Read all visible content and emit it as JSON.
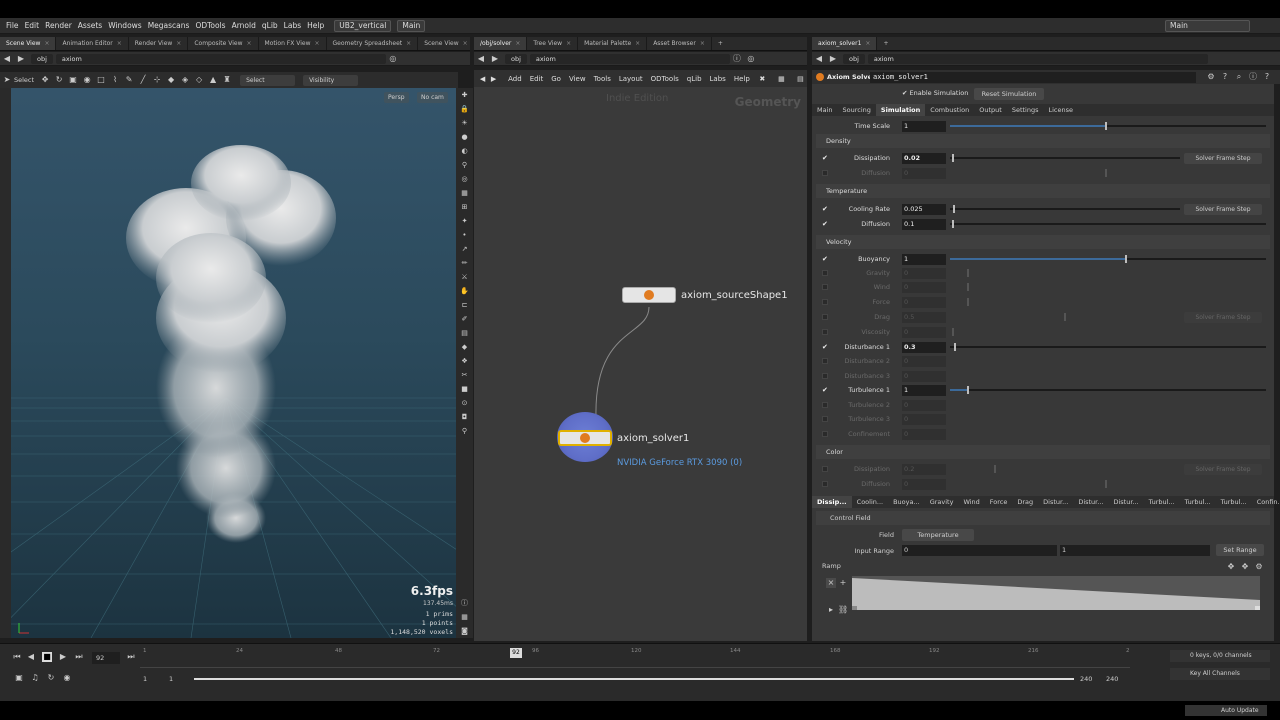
{
  "menu": [
    "File",
    "Edit",
    "Render",
    "Assets",
    "Windows",
    "Megascans",
    "ODTools",
    "Arnold",
    "qLib",
    "Labs",
    "Help"
  ],
  "desktop": "UB2_vertical",
  "desktop_main": "Main",
  "top_right_main": "Main",
  "left_tabs": [
    "Scene View",
    "Animation Editor",
    "Render View",
    "Composite View",
    "Motion FX View",
    "Geometry Spreadsheet",
    "Scene View"
  ],
  "mid_tabs": [
    "/obj/solver",
    "Tree View",
    "Material Palette",
    "Asset Browser"
  ],
  "right_tabs": [
    "axiom_solver1"
  ],
  "path_obj": "obj",
  "path_axiom": "axiom",
  "viewport": {
    "select": "Select",
    "select_mode": "Select",
    "visibility": "Visibility",
    "persp": "Persp",
    "cam": "No cam",
    "fps": "6.3fps",
    "ms": "137.45ms",
    "prims": "1  prims",
    "points": "1  points",
    "voxels": "1,148,520 voxels"
  },
  "network": {
    "menu": [
      "Add",
      "Edit",
      "Go",
      "View",
      "Tools",
      "Layout",
      "ODTools",
      "qLib",
      "Labs",
      "Help"
    ],
    "watermark1": "Indie Edition",
    "watermark2": "Geometry",
    "node1": "axiom_sourceShape1",
    "node2": "axiom_solver1",
    "gpu": "NVIDIA GeForce RTX 3090 (0)"
  },
  "params": {
    "type": "Axiom Solver",
    "name": "axiom_solver1",
    "enable_sim": "Enable Simulation",
    "reset_sim": "Reset Simulation",
    "tabs": [
      "Main",
      "Sourcing",
      "Simulation",
      "Combustion",
      "Output",
      "Settings",
      "License"
    ],
    "time_scale_label": "Time Scale",
    "time_scale": "1",
    "sec_density": "Density",
    "sec_temperature": "Temperature",
    "sec_velocity": "Velocity",
    "sec_color": "Color",
    "rows": {
      "dissipation": {
        "label": "Dissipation",
        "value": "0.02",
        "menu": "Solver Frame Step"
      },
      "diffusion": {
        "label": "Diffusion",
        "value": "0"
      },
      "cooling": {
        "label": "Cooling Rate",
        "value": "0.025",
        "menu": "Solver Frame Step"
      },
      "tdiffusion": {
        "label": "Diffusion",
        "value": "0.1"
      },
      "buoyancy": {
        "label": "Buoyancy",
        "value": "1"
      },
      "gravity": {
        "label": "Gravity",
        "value": "0"
      },
      "wind": {
        "label": "Wind",
        "value": "0"
      },
      "force": {
        "label": "Force",
        "value": "0"
      },
      "drag": {
        "label": "Drag",
        "value": "0.5",
        "menu": "Solver Frame Step"
      },
      "viscosity": {
        "label": "Viscosity",
        "value": "0"
      },
      "dist1": {
        "label": "Disturbance 1",
        "value": "0.3"
      },
      "dist2": {
        "label": "Disturbance 2",
        "value": "0"
      },
      "dist3": {
        "label": "Disturbance 3",
        "value": "0"
      },
      "turb1": {
        "label": "Turbulence 1",
        "value": "1"
      },
      "turb2": {
        "label": "Turbulence 2",
        "value": "0"
      },
      "turb3": {
        "label": "Turbulence 3",
        "value": "0"
      },
      "confinement": {
        "label": "Confinement",
        "value": "0"
      },
      "cdissipation": {
        "label": "Dissipation",
        "value": "0.2",
        "menu": "Solver Frame Step"
      },
      "cdiffusion": {
        "label": "Diffusion",
        "value": "0"
      }
    },
    "subtabs": [
      "Dissip...",
      "Coolin...",
      "Buoya...",
      "Gravity",
      "Wind",
      "Force",
      "Drag",
      "Distur...",
      "Distur...",
      "Distur...",
      "Turbul...",
      "Turbul...",
      "Turbul...",
      "Confin..."
    ],
    "control_field": "Control Field",
    "field_label": "Field",
    "field_value": "Temperature",
    "input_range_label": "Input Range",
    "input_range_min": "0",
    "input_range_max": "1",
    "set_range": "Set Range",
    "ramp": "Ramp"
  },
  "timeline": {
    "frame": "92",
    "ticks": [
      "1",
      "24",
      "48",
      "72",
      "96",
      "120",
      "144",
      "168",
      "192",
      "216",
      "2"
    ],
    "range_start": "1",
    "range_start2": "1",
    "range_end": "240",
    "range_end2": "240",
    "keys": "0 keys, 0/0 channels",
    "key_all": "Key All Channels",
    "auto_update": "Auto Update"
  }
}
